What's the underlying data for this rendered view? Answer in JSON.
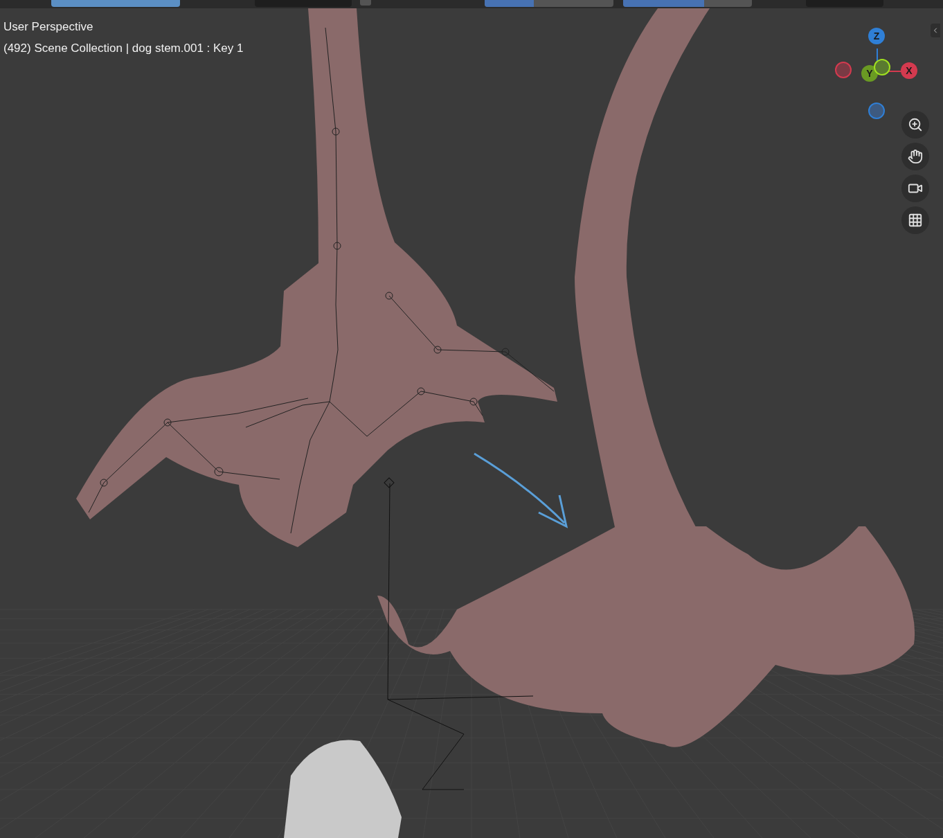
{
  "toolbar": {
    "mode_selected": true,
    "sliders": [
      {
        "level": 0.38
      },
      {
        "level": 0.63
      }
    ],
    "stabilize_checked": false
  },
  "viewport": {
    "view_name": "User Perspective",
    "object_info": "(492) Scene Collection | dog stem.001 : Key 1"
  },
  "gizmo": {
    "axes": [
      {
        "label": "Z",
        "color": "#2f7fd6"
      },
      {
        "label": "Y",
        "color": "#6a9a23"
      },
      {
        "label": "X",
        "color": "#d43a4f"
      }
    ]
  },
  "nav_buttons": [
    {
      "kind": "zoom"
    },
    {
      "kind": "pan"
    },
    {
      "kind": "camera"
    },
    {
      "kind": "ortho"
    }
  ]
}
